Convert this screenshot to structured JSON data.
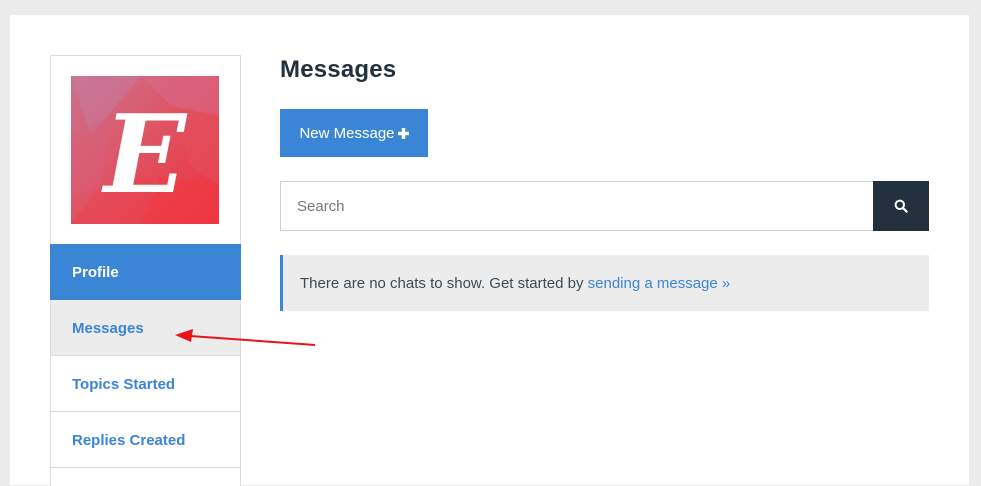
{
  "page": {
    "title": "Messages"
  },
  "sidebar": {
    "avatar_letter": "E",
    "items": [
      {
        "label": "Profile",
        "state": "active"
      },
      {
        "label": "Messages",
        "state": "hover"
      },
      {
        "label": "Topics Started",
        "state": "normal"
      },
      {
        "label": "Replies Created",
        "state": "normal"
      }
    ]
  },
  "actions": {
    "new_message_label": "New Message",
    "new_message_icon": "plus-icon"
  },
  "search": {
    "placeholder": "Search",
    "button_icon": "search-icon"
  },
  "notice": {
    "text": "There are no chats to show. Get started by",
    "link_text": "sending a message »"
  },
  "annotation": {
    "type": "red-arrow",
    "points_to": "Messages",
    "color": "#e8141a"
  },
  "colors": {
    "accent": "#3a85d6",
    "dark": "#23313f",
    "muted_bg": "#ececec"
  }
}
